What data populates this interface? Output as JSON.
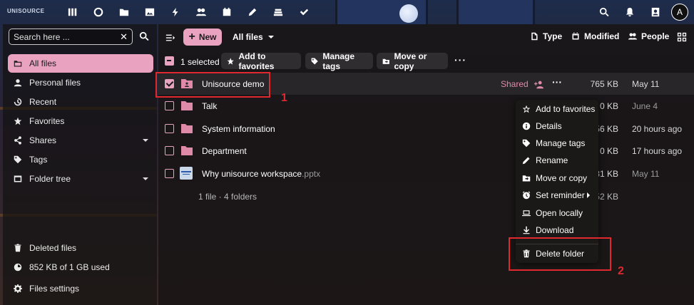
{
  "topbar": {
    "logo": "UNISOURCE",
    "apps": [
      "dashboard-icon",
      "search-circle-icon",
      "files-icon",
      "photos-icon",
      "activity-icon",
      "contacts-icon",
      "calendar-icon",
      "notes-icon",
      "deck-icon",
      "tasks-icon"
    ],
    "avatar_initial": "A"
  },
  "sidebar": {
    "search_placeholder": "Search here ...",
    "items": [
      {
        "label": "All files",
        "icon": "folder-icon",
        "active": true
      },
      {
        "label": "Personal files",
        "icon": "user-icon"
      },
      {
        "label": "Recent",
        "icon": "history-icon"
      },
      {
        "label": "Favorites",
        "icon": "star-icon"
      },
      {
        "label": "Shares",
        "icon": "share-icon",
        "expandable": true
      },
      {
        "label": "Tags",
        "icon": "tag-icon"
      },
      {
        "label": "Folder tree",
        "icon": "folder-tree-icon",
        "expandable": true
      }
    ],
    "deleted_files": "Deleted files",
    "quota": "852 KB of 1 GB used",
    "settings": "Files settings"
  },
  "header": {
    "new_label": "New",
    "breadcrumb": "All files",
    "filters": [
      "Type",
      "Modified",
      "People"
    ]
  },
  "actions": {
    "selected": "1 selected",
    "add_favorites": "Add to favorites",
    "manage_tags": "Manage tags",
    "move_copy": "Move or copy"
  },
  "files": [
    {
      "name": "Unisource demo",
      "ext": "",
      "type": "shared-folder",
      "shared": "Shared",
      "size": "765 KB",
      "date": "May 11",
      "selected": true
    },
    {
      "name": "Talk",
      "ext": "",
      "type": "folder",
      "size": "0 KB",
      "date": "June 4"
    },
    {
      "name": "System information",
      "ext": "",
      "type": "folder",
      "size": "56 KB",
      "date": "20 hours ago"
    },
    {
      "name": "Department",
      "ext": "",
      "type": "folder",
      "size": "0 KB",
      "date": "17 hours ago"
    },
    {
      "name": "Why unisource workspace",
      "ext": ".pptx",
      "type": "pptx",
      "size": "31 KB",
      "date": "May 11"
    }
  ],
  "summary": {
    "text": "1 file · 4 folders",
    "size": "852 KB"
  },
  "context_menu": [
    "Add to favorites",
    "Details",
    "Manage tags",
    "Rename",
    "Move or copy",
    "Set reminder",
    "Open locally",
    "Download",
    "Delete folder"
  ],
  "annotations": {
    "one": "1",
    "two": "2"
  },
  "colors": {
    "accent": "#e9a3c1",
    "annotation": "#e0282f"
  }
}
